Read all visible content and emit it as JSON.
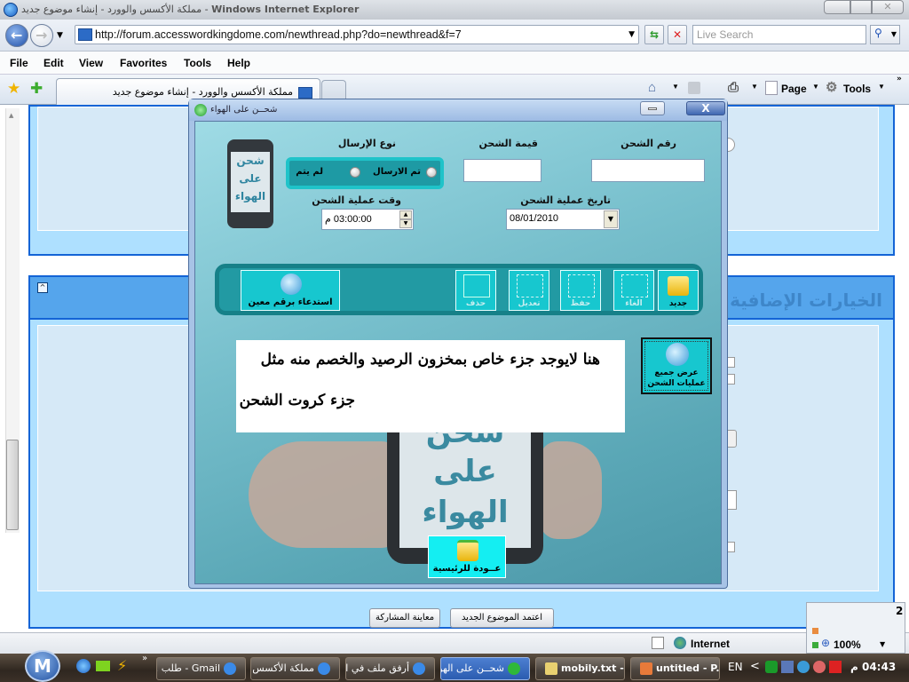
{
  "window": {
    "title_page": "مملكة الأكسس والوورد - إنشاء موضوع جديد",
    "title_app": "Windows Internet Explorer"
  },
  "addressbar": {
    "url": "http://forum.accesswordkingdome.com/newthread.php?do=newthread&f=7",
    "search_placeholder": "Live Search"
  },
  "menu": [
    "File",
    "Edit",
    "View",
    "Favorites",
    "Tools",
    "Help"
  ],
  "tabs": [
    {
      "label": "مملكة الأكسس والوورد - إنشاء موضوع جديد"
    }
  ],
  "commandbar": {
    "page": "Page",
    "tools": "Tools"
  },
  "forum": {
    "section_title": "الخيارات الإضافية",
    "preview_button": "معاينة المشاركة",
    "submit_button": "اعتمد الموضوع الجديد",
    "page_indicator": "2"
  },
  "statusbar": {
    "zone": "Internet",
    "zoom": "100%"
  },
  "dialog": {
    "title": "شحــن على الهواء",
    "phone_text": [
      "شحن",
      "على",
      "الهواء"
    ],
    "fields": {
      "charge_number_label": "رقم الشحن",
      "charge_number_value": "",
      "charge_value_label": "قيمة الشحن",
      "charge_value_value": "",
      "send_type_label": "نوع الإرسال",
      "send_option_sent": "تم الارسال",
      "send_option_not_sent": "لم يتم",
      "date_label": "تاريخ عملية الشحن",
      "date_value": "08/01/2010",
      "time_label": "وقت عملية الشحن",
      "time_value": "03:00:00 م"
    },
    "toolbar": {
      "new": "جديد",
      "cancel": "الغاء",
      "save": "حفظ",
      "edit": "تعديل",
      "delete": "حذف",
      "recall_by_number": "استدعاء برقم معين"
    },
    "show_all_button": "عرض جميع عمليات الشحن",
    "note": {
      "line1": "هنا لايوجد جزء خاص بمخزون الرصيد والخصم منه مثل",
      "line2": "جزء كروت الشحن"
    },
    "home_button": "عــودة للرئيسية"
  },
  "taskbar": {
    "start_label": "M",
    "items": [
      {
        "label": "Gmail - طلب ...",
        "active": false
      },
      {
        "label": "مملكة الأكسس وا...",
        "active": false
      },
      {
        "label": "أرفق ملف في الم...",
        "active": false
      },
      {
        "label": "شحــن على الهواء",
        "active": true
      },
      {
        "label": "mobily.txt -...",
        "active": false
      },
      {
        "label": "untitled - P...",
        "active": false
      }
    ],
    "language": "EN",
    "clock": "04:43 م"
  }
}
